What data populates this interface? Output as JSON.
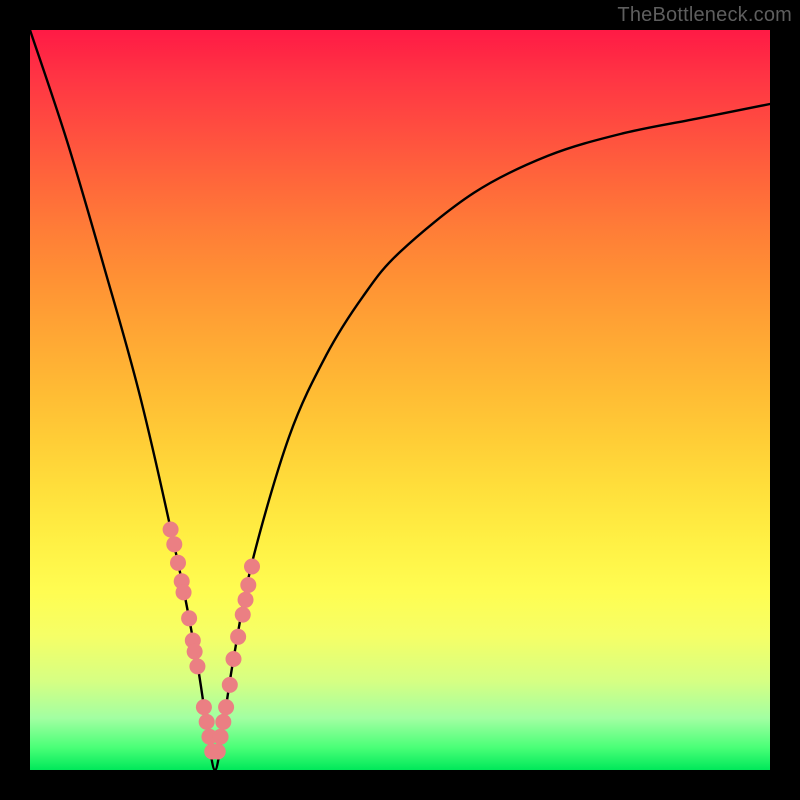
{
  "watermark": "TheBottleneck.com",
  "colors": {
    "background_frame": "#000000",
    "curve": "#000000",
    "marker_fill": "#eb7f83",
    "gradient_top": "#ff1a45",
    "gradient_bottom": "#00e85a"
  },
  "chart_data": {
    "type": "line",
    "title": "",
    "xlabel": "",
    "ylabel": "",
    "xlim": [
      -1,
      3
    ],
    "ylim": [
      0,
      1
    ],
    "grid": false,
    "legend": false,
    "note": "Interpretive V-shaped bottleneck curve. Axes unlabeled; values estimated from pixel geometry. y is normalized height (1=top, 0=bottom).",
    "series": [
      {
        "name": "bottleneck-curve",
        "x": [
          -1.0,
          -0.8,
          -0.6,
          -0.4,
          -0.2,
          -0.1,
          -0.05,
          0.0,
          0.05,
          0.1,
          0.2,
          0.4,
          0.6,
          0.8,
          1.0,
          1.4,
          1.8,
          2.2,
          2.6,
          3.0
        ],
        "y": [
          1.0,
          0.85,
          0.68,
          0.5,
          0.28,
          0.15,
          0.07,
          0.0,
          0.07,
          0.15,
          0.28,
          0.45,
          0.56,
          0.64,
          0.7,
          0.78,
          0.83,
          0.86,
          0.88,
          0.9
        ]
      }
    ],
    "markers": {
      "name": "highlight-dots",
      "color": "#eb7f83",
      "note": "Clusters of dots near the valley along both arms of the curve.",
      "x": [
        -0.24,
        -0.22,
        -0.2,
        -0.18,
        -0.17,
        -0.14,
        -0.12,
        -0.11,
        -0.095,
        -0.06,
        -0.045,
        -0.03,
        -0.015,
        0.015,
        0.03,
        0.045,
        0.06,
        0.08,
        0.1,
        0.125,
        0.15,
        0.165,
        0.18,
        0.2
      ],
      "y": [
        0.325,
        0.305,
        0.28,
        0.255,
        0.24,
        0.205,
        0.175,
        0.16,
        0.14,
        0.085,
        0.065,
        0.045,
        0.025,
        0.025,
        0.045,
        0.065,
        0.085,
        0.115,
        0.15,
        0.18,
        0.21,
        0.23,
        0.25,
        0.275
      ]
    }
  }
}
